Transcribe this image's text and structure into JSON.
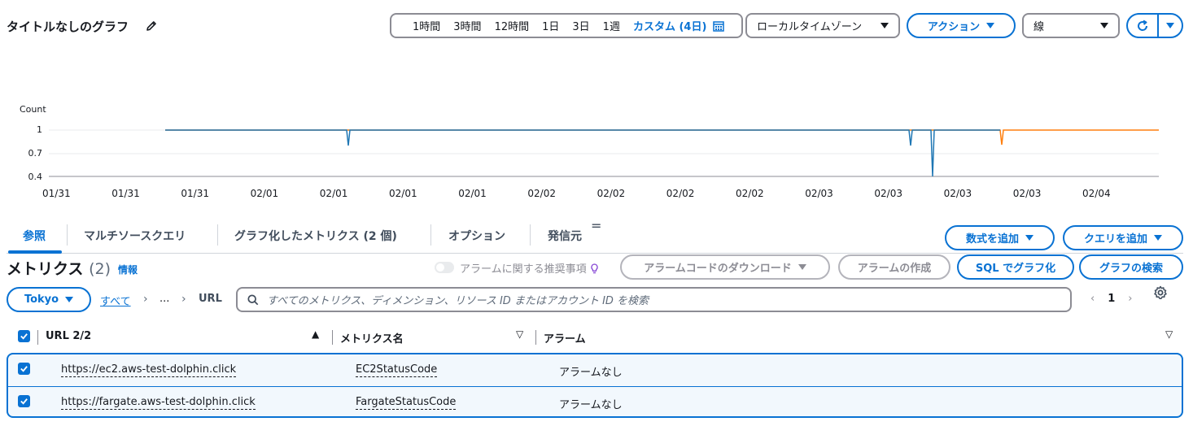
{
  "header": {
    "title": "タイトルなしのグラフ",
    "time_ranges": [
      "1時間",
      "3時間",
      "12時間",
      "1日",
      "3日",
      "1週"
    ],
    "custom_range": "カスタム (4日)",
    "timezone": "ローカルタイムゾーン",
    "actions": "アクション",
    "graph_type": "線"
  },
  "chart_data": {
    "type": "line",
    "ylabel": "Count",
    "ylim": [
      0.4,
      1
    ],
    "yticks": [
      "1",
      "0.7",
      "0.4"
    ],
    "x_tick_labels": [
      "01/31",
      "01/31",
      "01/31",
      "02/01",
      "02/01",
      "02/01",
      "02/01",
      "02/02",
      "02/02",
      "02/02",
      "02/02",
      "02/03",
      "02/03",
      "02/03",
      "02/03",
      "02/04"
    ],
    "series": [
      {
        "color": "#1f77b4",
        "values": [
          1,
          0.8,
          1,
          0.8,
          1,
          0.4,
          1
        ]
      },
      {
        "color": "#ff7f0e",
        "values": [
          1,
          1,
          0.8,
          1
        ]
      }
    ],
    "grid": "horizontal"
  },
  "tabs": [
    {
      "label": "参照"
    },
    {
      "label": "マルチソースクエリ"
    },
    {
      "label": "グラフ化したメトリクス (2 個)"
    },
    {
      "label": "オプション"
    },
    {
      "label": "発信元"
    }
  ],
  "tab_extra_icon": "=",
  "buttons": {
    "add_math": "数式を追加",
    "add_query": "クエリを追加",
    "download_alarm_code": "アラームコードのダウンロード",
    "create_alarm": "アラームの作成",
    "graph_with_sql": "SQL でグラフ化",
    "search_graphs": "グラフの検索"
  },
  "metrics": {
    "title": "メトリクス",
    "count": "(2)",
    "info": "情報",
    "alarm_recommendations": "アラームに関する推奨事項"
  },
  "filter": {
    "region": "Tokyo",
    "breadcrumb": [
      "すべて",
      "...",
      "URL"
    ],
    "search_placeholder": "すべてのメトリクス、ディメンション、リソース ID またはアカウント ID を検索",
    "page": "1"
  },
  "table": {
    "columns": [
      "URL 2/2",
      "メトリクス名",
      "アラーム"
    ],
    "rows": [
      {
        "url": "https://ec2.aws-test-dolphin.click",
        "metric": "EC2StatusCode",
        "alarm": "アラームなし"
      },
      {
        "url": "https://fargate.aws-test-dolphin.click",
        "metric": "FargateStatusCode",
        "alarm": "アラームなし"
      }
    ]
  }
}
